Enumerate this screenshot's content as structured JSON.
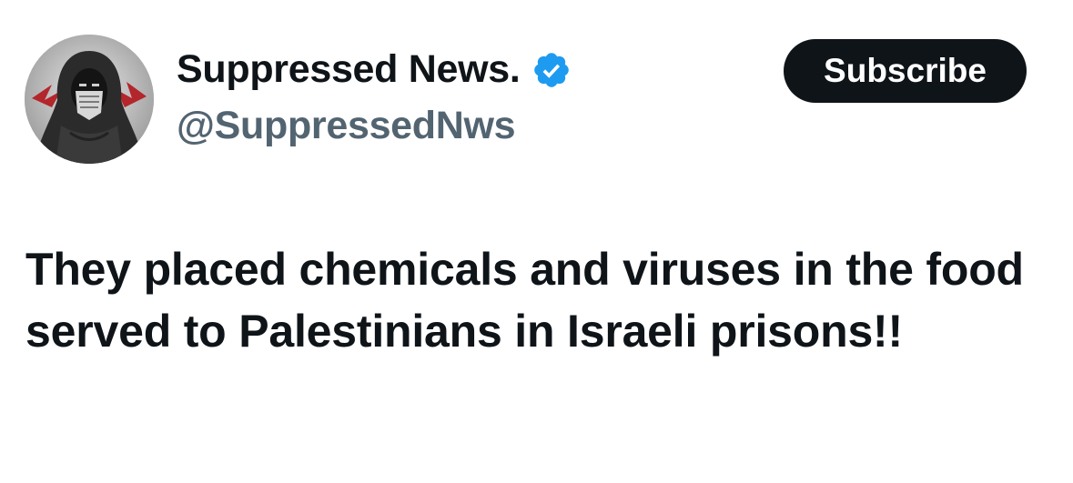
{
  "author": {
    "display_name": "Suppressed News.",
    "handle": "@SuppressedNws",
    "verified_icon": "verified-badge-icon",
    "avatar_icon": "hooded-figure-avatar"
  },
  "actions": {
    "subscribe_label": "Subscribe"
  },
  "tweet": {
    "text": "They placed chemicals and viruses in the food served to Palestinians in Israeli prisons!!"
  },
  "colors": {
    "text_primary": "#0f1419",
    "text_secondary": "#536471",
    "verified_blue": "#1d9bf0",
    "button_bg": "#0f1419",
    "button_text": "#ffffff",
    "background": "#ffffff"
  }
}
